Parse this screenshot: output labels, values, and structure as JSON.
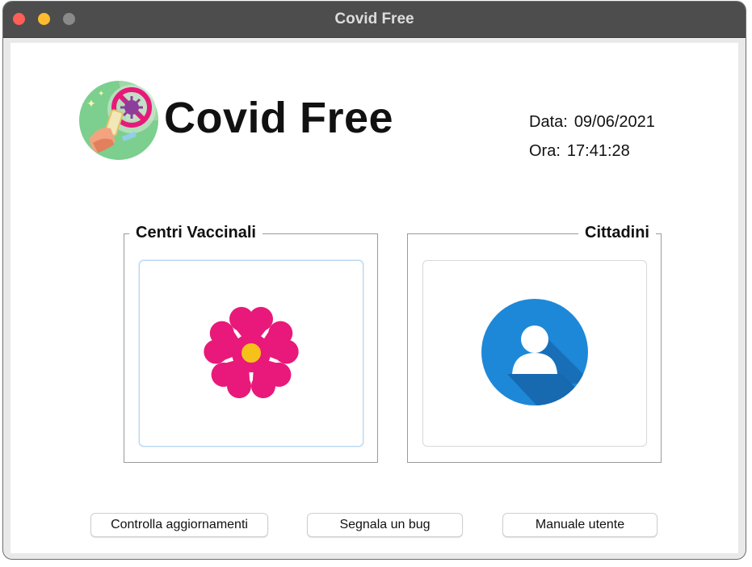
{
  "window": {
    "title": "Covid Free"
  },
  "header": {
    "app_title": "Covid Free",
    "logo_icon": "vaccine-virus-logo-icon",
    "date_label": "Data:",
    "date_value": "09/06/2021",
    "time_label": "Ora:",
    "time_value": "17:41:28"
  },
  "groups": {
    "centri": {
      "title": "Centri Vaccinali",
      "icon": "flower-icon",
      "icon_color": "#e8197a",
      "icon_center_color": "#f6c21a"
    },
    "cittadini": {
      "title": "Cittadini",
      "icon": "user-icon",
      "icon_color": "#1e88d8"
    }
  },
  "buttons": {
    "updates": "Controlla aggiornamenti",
    "bug": "Segnala un bug",
    "manual": "Manuale utente"
  }
}
